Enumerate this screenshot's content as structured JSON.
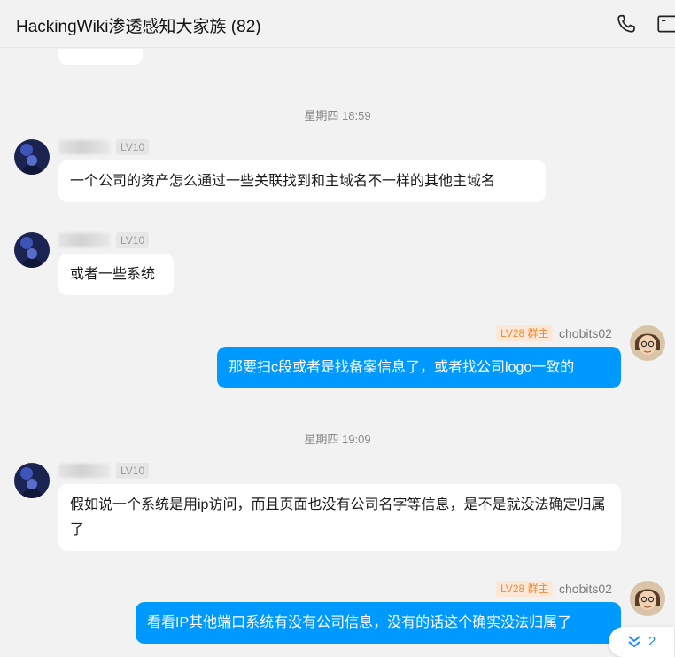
{
  "header": {
    "title": "HackingWiki渗透感知大家族 (82)",
    "icons": [
      "phone-icon",
      "window-icon"
    ]
  },
  "chat": {
    "separators": [
      {
        "text": "星期四 18:59"
      },
      {
        "text": "星期四 19:09"
      }
    ],
    "messages": [
      {
        "sender": "",
        "level": "LV10",
        "text": "一个公司的资产怎么通过一些关联找到和主域名不一样的其他主域名",
        "self": false
      },
      {
        "sender": "",
        "level": "LV10",
        "text": "或者一些系统",
        "self": false
      },
      {
        "sender": "chobits02",
        "level": "LV28 群主",
        "text": "那要扫c段或者是找备案信息了，或者找公司logo一致的",
        "self": true
      },
      {
        "sender": "",
        "level": "LV10",
        "text": "假如说一个系统是用ip访问，而且页面也没有公司名字等信息，是不是就没法确定归属了",
        "self": false
      },
      {
        "sender": "chobits02",
        "level": "LV28 群主",
        "text": "看看IP其他端口系统有没有公司信息，没有的话这个确实没法归属了",
        "self": true
      }
    ]
  },
  "new_messages": {
    "count": "2",
    "icon": "double-chevron-down-icon"
  },
  "colors": {
    "self_bubble": "#0099ff",
    "other_bubble": "#ffffff",
    "background": "#f2f2f2",
    "owner_badge": "#f08a3c"
  }
}
